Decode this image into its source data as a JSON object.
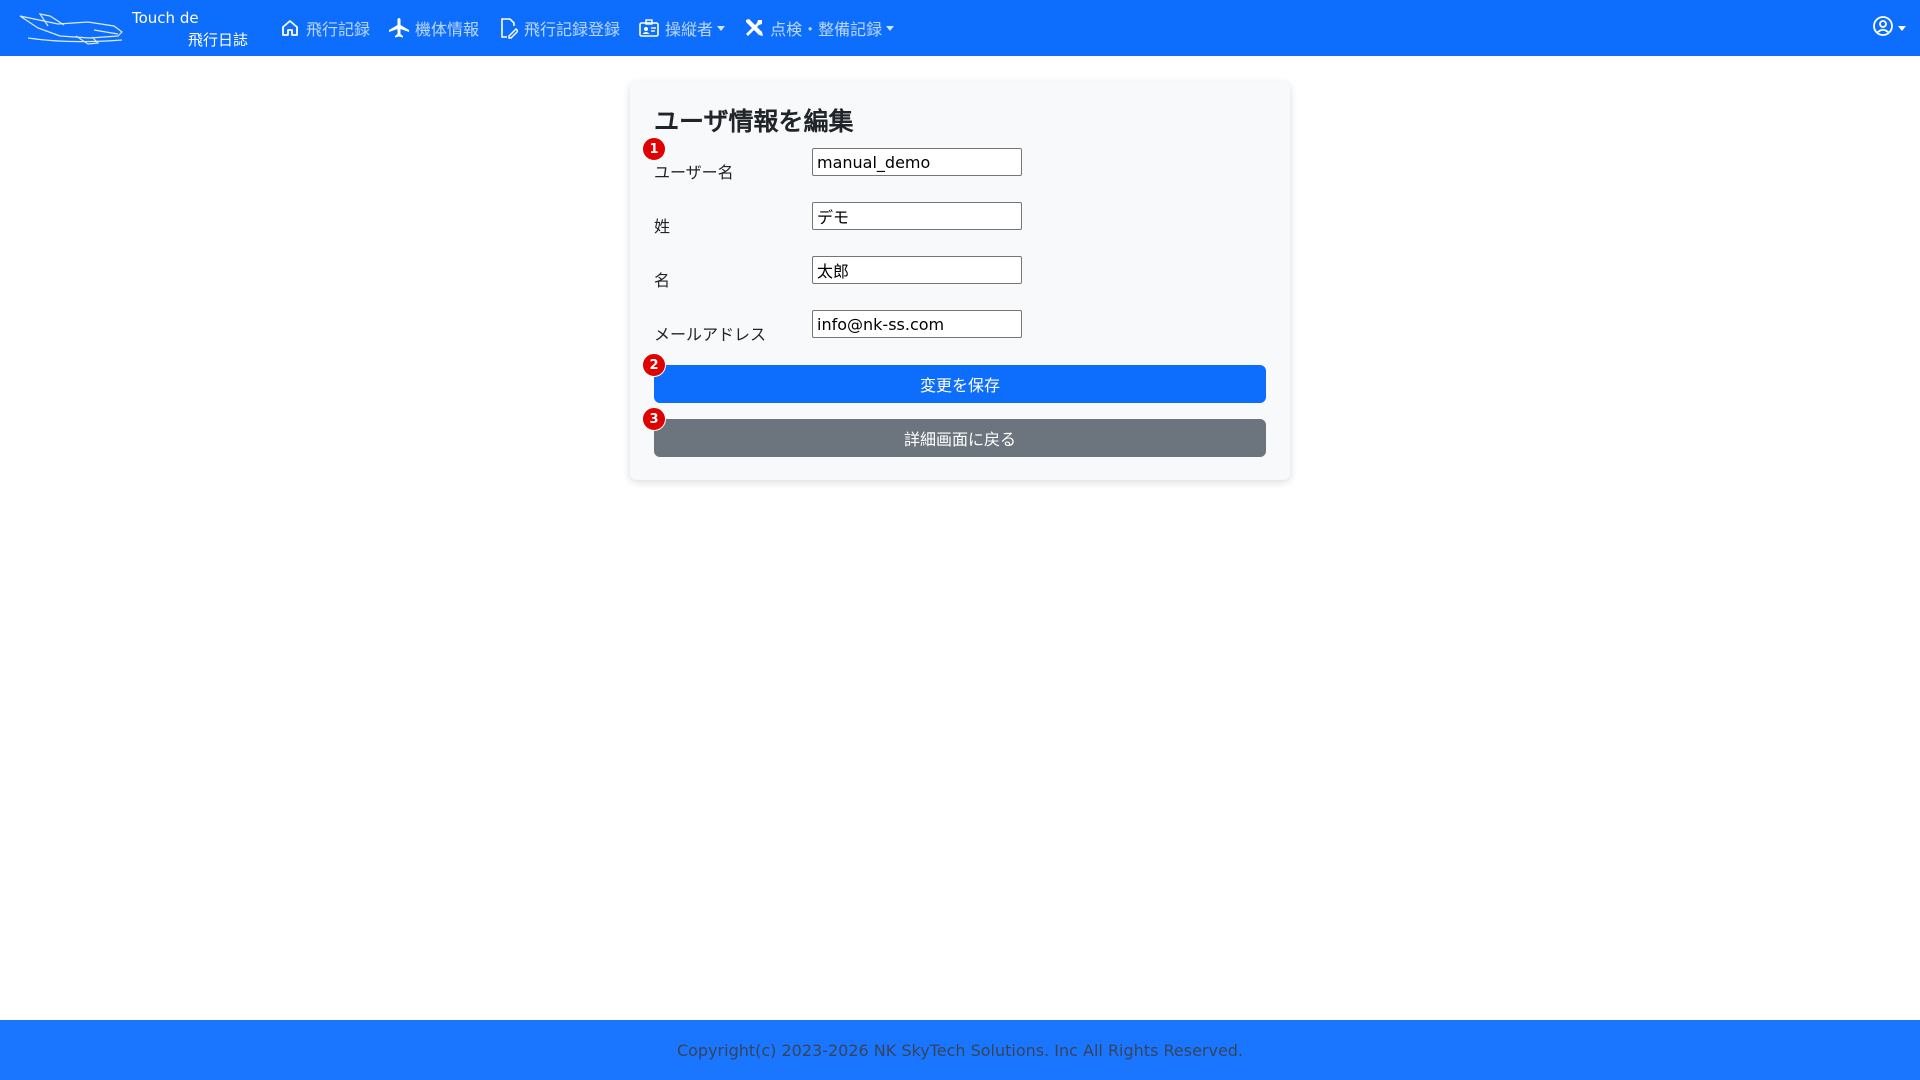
{
  "navbar": {
    "brand_line1": "Touch de",
    "brand_line2": "飛行日誌",
    "items": [
      {
        "label": "飛行記録",
        "icon": "home-icon"
      },
      {
        "label": "機体情報",
        "icon": "airplane-icon"
      },
      {
        "label": "飛行記録登録",
        "icon": "edit-document-icon"
      },
      {
        "label": "操縦者",
        "icon": "id-card-icon",
        "dropdown": true
      },
      {
        "label": "点検・整備記録",
        "icon": "tools-icon",
        "dropdown": true
      }
    ],
    "user_icon": "user-circle-icon"
  },
  "form": {
    "title": "ユーザ情報を編集",
    "fields": [
      {
        "label": "ユーザー名",
        "value": "manual_demo"
      },
      {
        "label": "姓",
        "value": "デモ"
      },
      {
        "label": "名",
        "value": "太郎"
      },
      {
        "label": "メールアドレス",
        "value": "info@nk-ss.com"
      }
    ],
    "save_label": "変更を保存",
    "back_label": "詳細画面に戻る",
    "badges": [
      "1",
      "2",
      "3"
    ]
  },
  "footer": {
    "copyright": "Copyright(c) 2023-2026 NK SkyTech Solutions. Inc All Rights Reserved."
  },
  "colors": {
    "primary": "#0d6efd",
    "secondary": "#6c757d",
    "badge": "#e00000",
    "footer": "#1a75ff"
  }
}
